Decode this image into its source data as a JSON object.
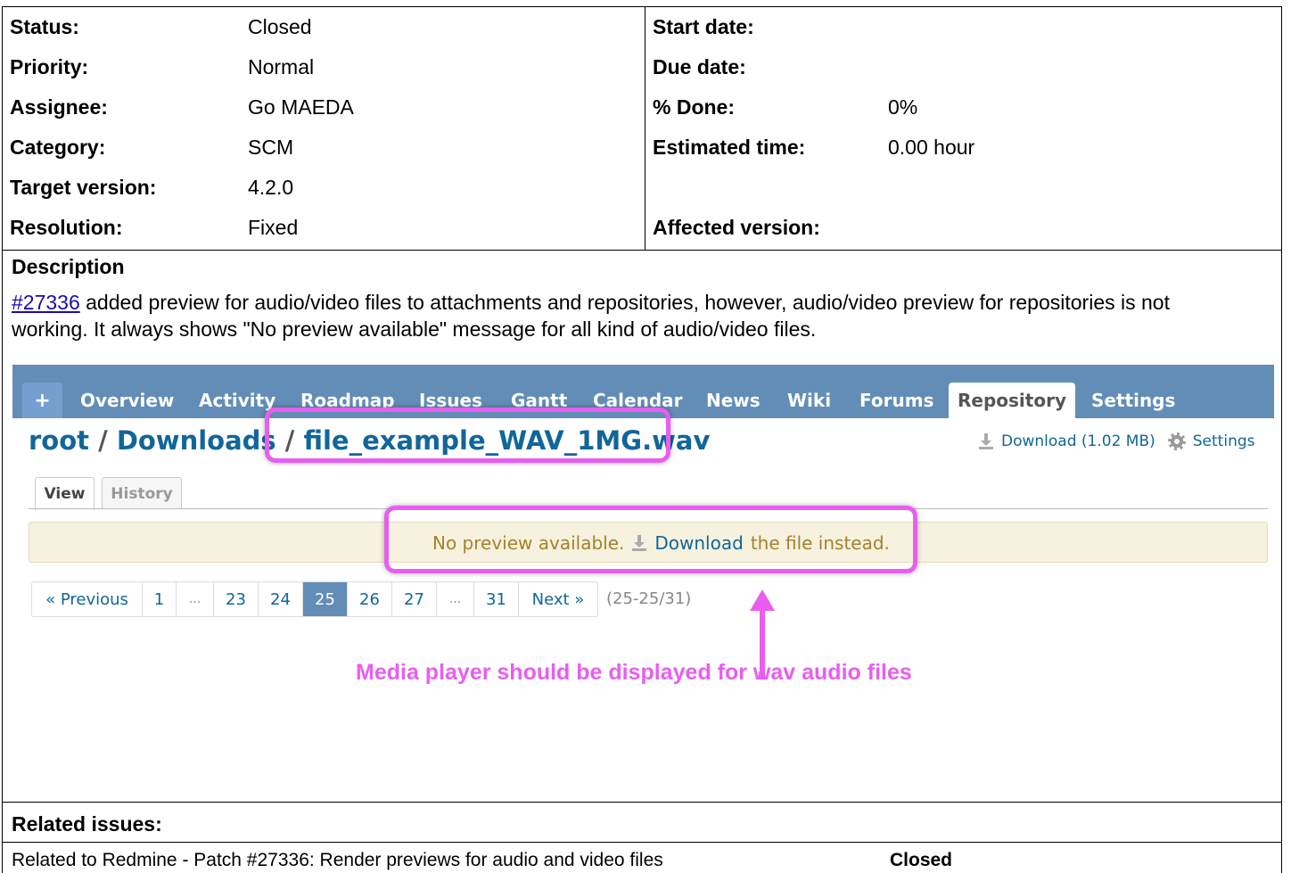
{
  "attributes": {
    "left": [
      {
        "label": "Status:",
        "value": "Closed"
      },
      {
        "label": "Priority:",
        "value": "Normal"
      },
      {
        "label": "Assignee:",
        "value": "Go MAEDA"
      },
      {
        "label": "Category:",
        "value": "SCM"
      },
      {
        "label": "Target version:",
        "value": "4.2.0"
      },
      {
        "label": "Resolution:",
        "value": "Fixed"
      }
    ],
    "right": [
      {
        "label": "Start date:",
        "value": ""
      },
      {
        "label": "Due date:",
        "value": ""
      },
      {
        "label": "% Done:",
        "value": "0%"
      },
      {
        "label": "Estimated time:",
        "value": "0.00 hour"
      },
      {
        "label": "",
        "value": ""
      },
      {
        "label": "Affected version:",
        "value": ""
      }
    ]
  },
  "description": {
    "heading": "Description",
    "issue_link": "#27336",
    "text": " added preview for audio/video files to attachments and repositories, however, audio/video preview for repositories is not working. It always shows \"No preview available\" message for all kind of audio/video files."
  },
  "screenshot": {
    "nav": [
      {
        "label": "+"
      },
      {
        "label": "Overview"
      },
      {
        "label": "Activity"
      },
      {
        "label": "Roadmap"
      },
      {
        "label": "Issues"
      },
      {
        "label": "Gantt"
      },
      {
        "label": "Calendar"
      },
      {
        "label": "News"
      },
      {
        "label": "Wiki"
      },
      {
        "label": "Forums"
      },
      {
        "label": "Repository"
      },
      {
        "label": "Settings"
      }
    ],
    "breadcrumb": {
      "root": "root",
      "sep1": " / ",
      "folder": "Downloads",
      "sep2": " / ",
      "file": "file_example_WAV_1MG.wav"
    },
    "contextual": {
      "download": "Download (1.02 MB)",
      "settings": "Settings"
    },
    "tabs": {
      "view": "View",
      "history": "History"
    },
    "flash": {
      "prefix": "No preview available.",
      "link": "Download",
      "suffix": "the file instead."
    },
    "pagination": {
      "pages": [
        "« Previous",
        "1",
        "...",
        "23",
        "24",
        "25",
        "26",
        "27",
        "...",
        "31",
        "Next »"
      ],
      "current": "25",
      "count": "(25-25/31)"
    },
    "annotation": "Media player should be displayed for wav audio files",
    "highlight_color": "#e85ef0"
  },
  "related": {
    "heading": "Related issues:",
    "items": [
      {
        "text": "Related to Redmine - Patch #27336: Render previews for audio and video files",
        "status": "Closed"
      }
    ]
  }
}
